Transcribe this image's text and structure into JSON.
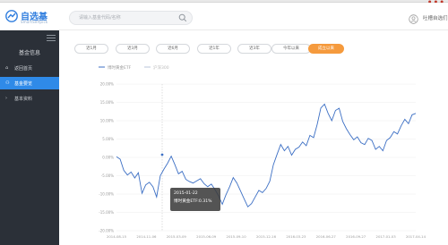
{
  "header": {
    "logo_text": "自选基",
    "logo_sub": "SmartSelfpick",
    "search_placeholder": "请输入基金代码/名称",
    "user_label": "吐槽自选们"
  },
  "sidebar": {
    "title": "基金信息",
    "items": [
      {
        "label": "返回首页",
        "icon": "home-icon"
      },
      {
        "label": "基金要览",
        "icon": "sitemap-icon"
      },
      {
        "label": "基本资料",
        "icon": "chevron-right-icon"
      }
    ]
  },
  "tabs": [
    "近1月",
    "近3月",
    "近6月",
    "近1年",
    "近3年",
    "今年以来",
    "成立以来"
  ],
  "tooltip": {
    "date": "2015-01-22",
    "label": "博时黄金ETF:0.31%"
  },
  "colors": {
    "accent": "#2f8ae8",
    "tab_active": "#f59a3d",
    "series1": "#3c6fc4",
    "series2": "#b9c4d8"
  },
  "chart_data": {
    "type": "line",
    "legend": [
      "博时黄金ETF",
      "沪深300"
    ],
    "legend_position": "top-left",
    "ylim": [
      -20,
      20
    ],
    "y_ticks": [
      "20.00%",
      "15.00%",
      "10.00%",
      "5.00%",
      "0.00%",
      "-5.00%",
      "-10.00%",
      "-15.00%",
      "-20.00%"
    ],
    "x_ticks": [
      "2014-08-15",
      "2014-11-06",
      "2015-03-09",
      "2015-06-09",
      "2015-09-10",
      "2015-12-16",
      "2016-03-23",
      "2016-06-27",
      "2016-09-27",
      "2017-01-03",
      "2017-04-14"
    ],
    "series": [
      {
        "name": "博时黄金ETF",
        "values": [
          0.2,
          -0.5,
          -3.5,
          -4.8,
          -4.0,
          -5.6,
          -4.2,
          -9.8,
          -7.5,
          -6.8,
          -8.0,
          -10.8,
          -5.0,
          -3.2,
          -1.6,
          0.31,
          -2.0,
          -4.5,
          -3.8,
          -6.0,
          -6.6,
          -7.0,
          -6.4,
          -5.8,
          -7.2,
          -8.0,
          -7.3,
          -8.8,
          -10.5,
          -12.8,
          -10.2,
          -8.0,
          -5.5,
          -7.0,
          -9.2,
          -11.4,
          -13.5,
          -12.6,
          -10.8,
          -9.0,
          -9.6,
          -8.5,
          -6.5,
          -2.0,
          0.8,
          3.5,
          1.8,
          3.0,
          0.6,
          2.2,
          2.8,
          4.2,
          3.2,
          6.0,
          5.4,
          9.0,
          13.5,
          14.5,
          12.0,
          10.0,
          12.8,
          13.4,
          9.8,
          7.8,
          6.2,
          4.8,
          5.6,
          4.0,
          3.5,
          5.2,
          4.6,
          2.2,
          3.0,
          1.8,
          4.6,
          5.4,
          7.0,
          6.4,
          8.6,
          10.4,
          9.2,
          11.6,
          12.0
        ]
      }
    ]
  }
}
